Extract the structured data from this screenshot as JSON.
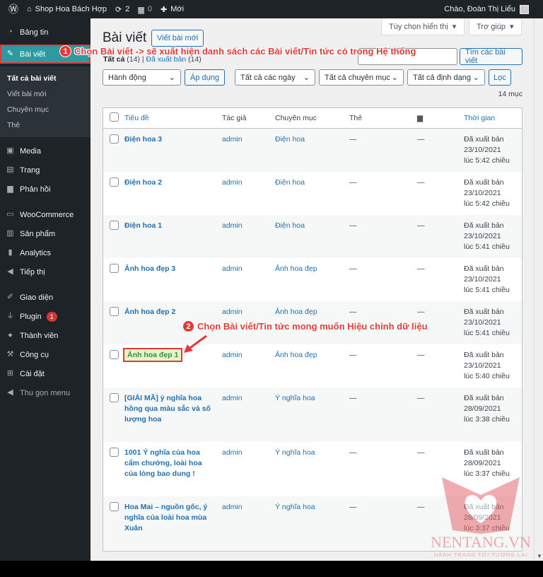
{
  "adminbar": {
    "site": "Shop Hoa Bách Hợp",
    "updates": "2",
    "comments": "0",
    "new": "Mới",
    "greeting": "Chào, Đoàn Thị Liểu"
  },
  "sidebar": {
    "items": [
      {
        "label": "Bảng tin",
        "icon": "dashboard-icon"
      },
      {
        "label": "Bài viết",
        "icon": "pin-icon"
      },
      {
        "label": "Media",
        "icon": "media-icon"
      },
      {
        "label": "Trang",
        "icon": "page-icon"
      },
      {
        "label": "Phản hồi",
        "icon": "comment-icon"
      },
      {
        "label": "WooCommerce",
        "icon": "woo-icon"
      },
      {
        "label": "Sản phẩm",
        "icon": "product-icon"
      },
      {
        "label": "Analytics",
        "icon": "chart-icon"
      },
      {
        "label": "Tiếp thị",
        "icon": "megaphone-icon"
      },
      {
        "label": "Giao diện",
        "icon": "brush-icon"
      },
      {
        "label": "Plugin",
        "icon": "plugin-icon",
        "badge": "1"
      },
      {
        "label": "Thành viên",
        "icon": "user-icon"
      },
      {
        "label": "Công cụ",
        "icon": "wrench-icon"
      },
      {
        "label": "Cài đặt",
        "icon": "settings-icon"
      },
      {
        "label": "Thu gọn menu",
        "icon": "collapse-icon"
      }
    ],
    "submenu": [
      "Tất cả bài viết",
      "Viết bài mới",
      "Chuyên mục",
      "Thẻ"
    ]
  },
  "screen_options": "Tùy chọn hiển thị",
  "help": "Trợ giúp",
  "page_title": "Bài viết",
  "add_new": "Viết bài mới",
  "views": {
    "all": "Tất cả",
    "all_count": "(14)",
    "sep": "|",
    "published": "Đã xuất bản",
    "published_count": "(14)"
  },
  "search_button": "Tìm các bài viết",
  "bulk_action": "Hành động",
  "apply": "Áp dụng",
  "dates": "Tất cả các ngày",
  "categories": "Tất cả chuyên mục",
  "formats": "Tất cả định dạng",
  "filter": "Lọc",
  "count": "14 mục",
  "columns": {
    "title": "Tiêu đề",
    "author": "Tác giả",
    "category": "Chuyên mục",
    "tags": "Thẻ",
    "date": "Thời gian"
  },
  "posts": [
    {
      "title": "Điện hoa 3",
      "author": "admin",
      "category": "Điện hoa",
      "tags": "—",
      "comments": "—",
      "status": "Đã xuất bản",
      "date": "23/10/2021",
      "time": "lúc 5:42 chiều"
    },
    {
      "title": "Điện hoa 2",
      "author": "admin",
      "category": "Điện hoa",
      "tags": "—",
      "comments": "—",
      "status": "Đã xuất bản",
      "date": "23/10/2021",
      "time": "lúc 5:42 chiều"
    },
    {
      "title": "Điện hoa 1",
      "author": "admin",
      "category": "Điện hoa",
      "tags": "—",
      "comments": "—",
      "status": "Đã xuất bản",
      "date": "23/10/2021",
      "time": "lúc 5:41 chiều"
    },
    {
      "title": "Ảnh hoa đẹp 3",
      "author": "admin",
      "category": "Ảnh hoa đẹp",
      "tags": "—",
      "comments": "—",
      "status": "Đã xuất bản",
      "date": "23/10/2021",
      "time": "lúc 5:41 chiều"
    },
    {
      "title": "Ảnh hoa đẹp 2",
      "author": "admin",
      "category": "Ảnh hoa đẹp",
      "tags": "—",
      "comments": "—",
      "status": "Đã xuất bản",
      "date": "23/10/2021",
      "time": "lúc 5:41 chiều"
    },
    {
      "title": "Ảnh hoa đẹp 1",
      "author": "admin",
      "category": "Ảnh hoa đẹp",
      "tags": "—",
      "comments": "—",
      "status": "Đã xuất bản",
      "date": "23/10/2021",
      "time": "lúc 5:40 chiều"
    },
    {
      "title": "[GIẢI MÃ] ý nghĩa hoa hồng qua màu sắc và số lượng hoa",
      "author": "admin",
      "category": "Ý nghĩa hoa",
      "tags": "—",
      "comments": "—",
      "status": "Đã xuất bản",
      "date": "28/09/2021",
      "time": "lúc 3:38 chiều"
    },
    {
      "title": "1001 Ý nghĩa của hoa cẩm chướng, loài hoa của lòng bao dung !",
      "author": "admin",
      "category": "Ý nghĩa hoa",
      "tags": "—",
      "comments": "—",
      "status": "Đã xuất bản",
      "date": "28/09/2021",
      "time": "lúc 3:37 chiều"
    },
    {
      "title": "Hoa Mai – nguồn gốc, ý nghĩa của loài hoa mùa Xuân",
      "author": "admin",
      "category": "Ý nghĩa hoa",
      "tags": "—",
      "comments": "—",
      "status": "Đã xuất bản",
      "date": "28/09/2021",
      "time": "lúc 3:37 chiều"
    }
  ],
  "annotations": {
    "step1_num": "1",
    "step1": "Chọn Bài viết -> sẽ xuất hiện danh sách các Bài viết/Tin tức có trong Hệ thống",
    "step2_num": "2",
    "step2": "Chọn Bài viết/Tin tức mong muốn Hiệu chỉnh dữ liệu"
  },
  "watermark": {
    "name": "NENTANG.VN",
    "tagline": "HÀNH TRANG TỚI TƯƠNG LAI"
  }
}
